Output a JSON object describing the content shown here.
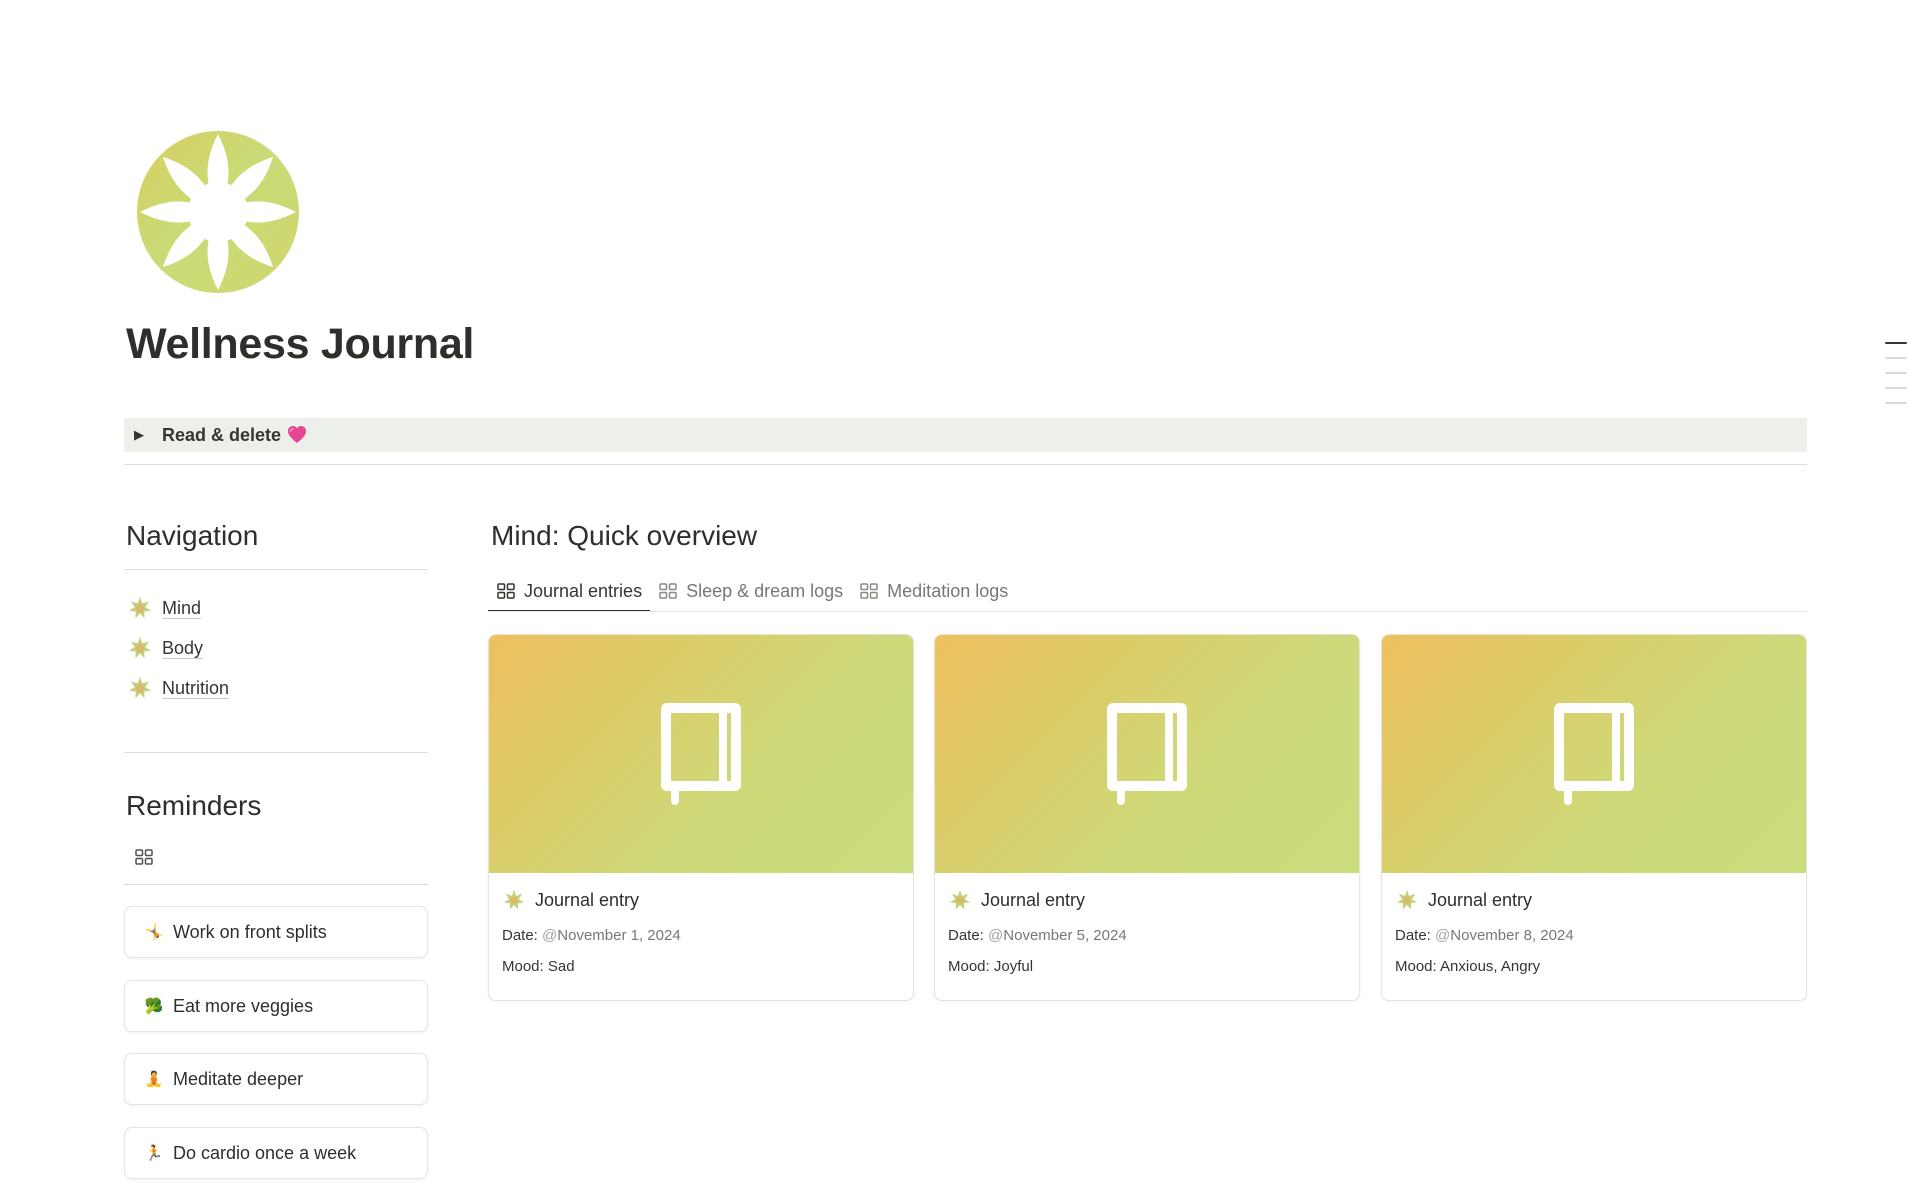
{
  "page": {
    "title": "Wellness Journal",
    "toggle_label": "Read & delete"
  },
  "navigation": {
    "heading": "Navigation",
    "items": [
      {
        "label": "Mind"
      },
      {
        "label": "Body"
      },
      {
        "label": "Nutrition"
      }
    ]
  },
  "reminders": {
    "heading": "Reminders",
    "items": [
      {
        "emoji": "🤸",
        "label": "Work on front splits"
      },
      {
        "emoji": "🥦",
        "label": "Eat more veggies"
      },
      {
        "emoji": "🧘",
        "label": "Meditate deeper"
      },
      {
        "emoji": "🏃",
        "label": "Do cardio once a week"
      }
    ]
  },
  "overview": {
    "heading": "Mind: Quick overview",
    "tabs": [
      {
        "label": "Journal entries",
        "active": true
      },
      {
        "label": "Sleep & dream logs",
        "active": false
      },
      {
        "label": "Meditation logs",
        "active": false
      }
    ],
    "cards": [
      {
        "title": "Journal entry",
        "date_label": "Date:",
        "date_at": "@",
        "date": "November 1, 2024",
        "mood_label": "Mood:",
        "mood": "Sad"
      },
      {
        "title": "Journal entry",
        "date_label": "Date:",
        "date_at": "@",
        "date": "November 5, 2024",
        "mood_label": "Mood:",
        "mood": "Joyful"
      },
      {
        "title": "Journal entry",
        "date_label": "Date:",
        "date_at": "@",
        "date": "November 8, 2024",
        "mood_label": "Mood:",
        "mood": "Anxious, Angry"
      }
    ]
  },
  "colors": {
    "accent_yellow": "#efbf5e",
    "accent_green": "#c9dd7c",
    "toggle_bg": "#edf0ea",
    "text": "#37352f"
  }
}
